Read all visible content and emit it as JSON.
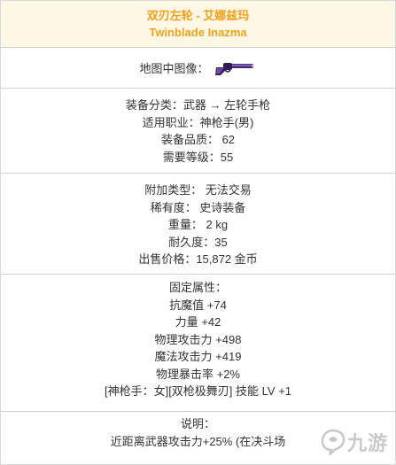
{
  "header": {
    "title_cn": "双刃左轮 - 艾娜兹玛",
    "title_en": "Twinblade Inazma"
  },
  "map": {
    "label": "地图中图像：",
    "icon": "revolver-icon"
  },
  "equip": {
    "category": "装备分类：武器 → 左轮手枪",
    "job": "适用职业：神枪手(男)",
    "quality": "装备品质： 62",
    "level": "需要等级：55"
  },
  "extra": {
    "trade": "附加类型： 无法交易",
    "rarity": "稀有度： 史诗装备",
    "weight": "重量： 2 kg",
    "durability": "耐久度：35",
    "price": "出售价格：15,872 金币"
  },
  "stats": {
    "header": "固定属性：",
    "items": [
      "抗魔值 +74",
      "力量 +42",
      "物理攻击力 +498",
      "魔法攻击力 +419",
      "物理暴击率 +2%",
      "[神枪手：女][双枪极舞刃] 技能 LV +1"
    ]
  },
  "desc": {
    "header": "说明：",
    "text": "近距离武器攻击力+25% (在决斗场"
  },
  "watermark": {
    "text": "九游",
    "icon": "jiuyou-logo-icon"
  },
  "colors": {
    "title": "#f0a21a",
    "header_bg": "#fdf7e6",
    "divider": "#cfcfcf",
    "text": "#333333"
  }
}
